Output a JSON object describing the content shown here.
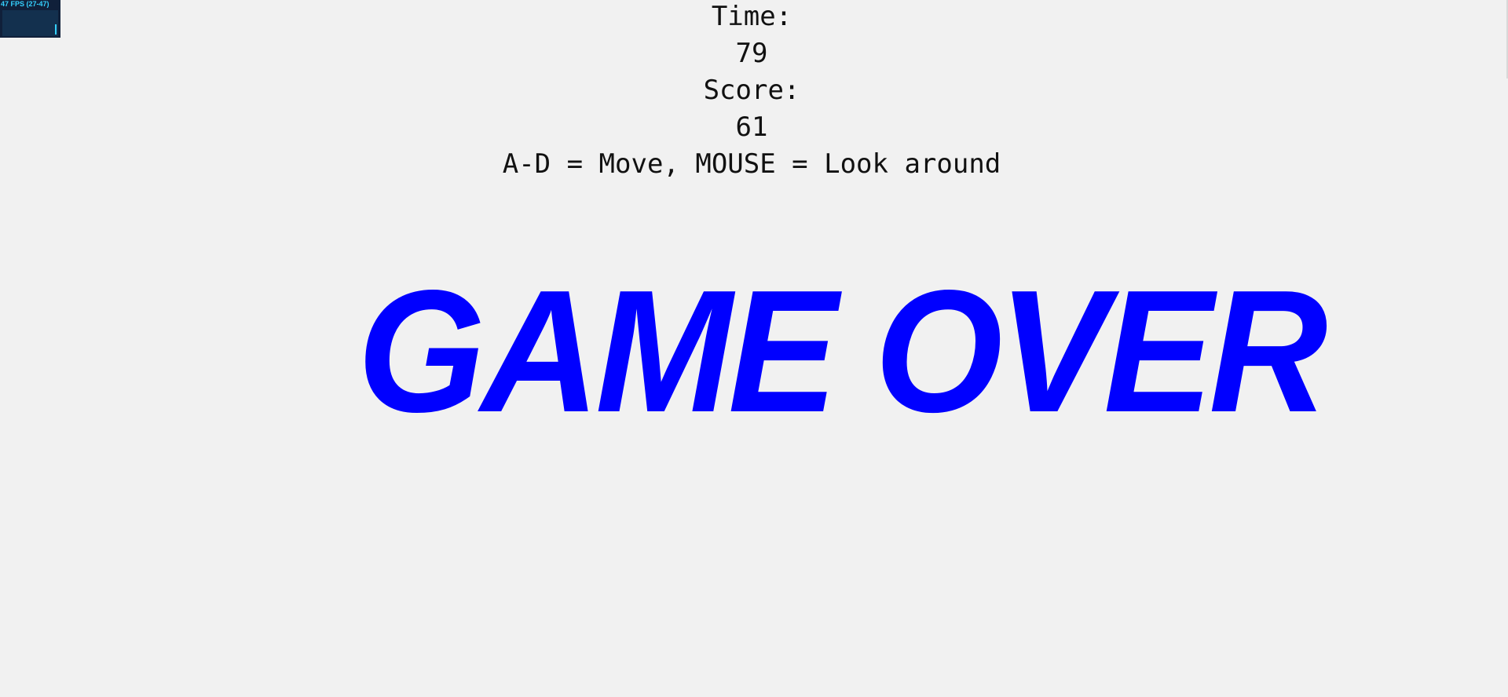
{
  "fps_panel": {
    "label": "47 FPS (27-47)",
    "color": "#35d1ff"
  },
  "hud": {
    "time_label": "Time:",
    "time_value": "79",
    "score_label": "Score:",
    "score_value": "61",
    "controls_hint": "A-D = Move, MOUSE = Look around"
  },
  "banner": {
    "text": "GAME OVER",
    "color": "#0000ff"
  },
  "background_color": "#f1f1f1"
}
